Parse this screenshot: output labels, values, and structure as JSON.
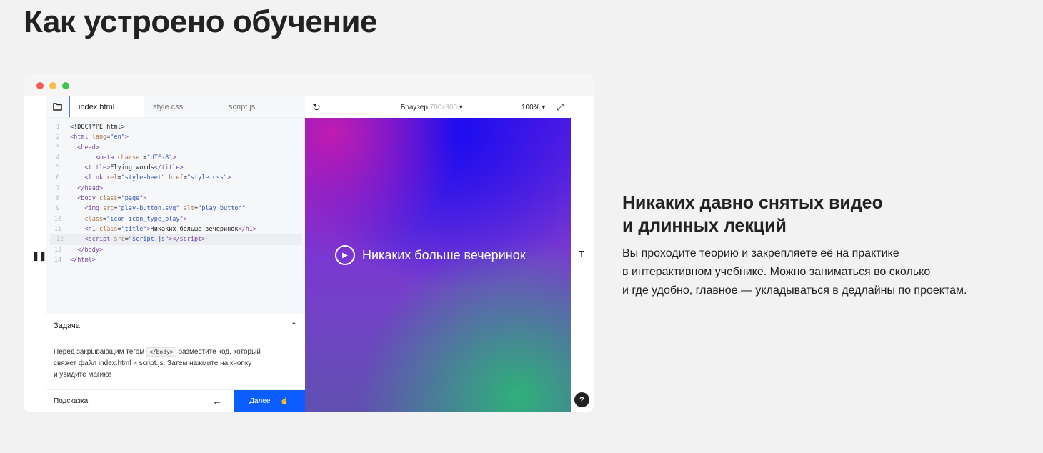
{
  "page_title": "Как устроено обучение",
  "window": {
    "tabs": [
      "index.html",
      "style.css",
      "script.js"
    ],
    "code": [
      [
        [
          "tx",
          "<!DOCTYPE html>"
        ]
      ],
      [
        [
          "tg",
          "<html "
        ],
        [
          "at",
          "lang"
        ],
        [
          "tx",
          "="
        ],
        [
          "st",
          "\"en\""
        ],
        [
          "tg",
          ">"
        ]
      ],
      [
        [
          "tg",
          "  <head>"
        ]
      ],
      [
        [
          "tg",
          "       <meta "
        ],
        [
          "at",
          "charset"
        ],
        [
          "tx",
          "="
        ],
        [
          "st",
          "\"UTF-8\""
        ],
        [
          "tg",
          ">"
        ]
      ],
      [
        [
          "tg",
          "    <title>"
        ],
        [
          "tx",
          "Flying words"
        ],
        [
          "tg",
          "</title>"
        ]
      ],
      [
        [
          "tg",
          "    <link "
        ],
        [
          "at",
          "rel"
        ],
        [
          "tx",
          "="
        ],
        [
          "st",
          "\"stylesheet\" "
        ],
        [
          "at",
          "href"
        ],
        [
          "tx",
          "="
        ],
        [
          "st",
          "\"style.css\""
        ],
        [
          "tg",
          ">"
        ]
      ],
      [
        [
          "tg",
          "  </head>"
        ]
      ],
      [
        [
          "tg",
          "  <body "
        ],
        [
          "at",
          "class"
        ],
        [
          "tx",
          "="
        ],
        [
          "st",
          "\"page\""
        ],
        [
          "tg",
          ">"
        ]
      ],
      [
        [
          "tg",
          "    <img "
        ],
        [
          "at",
          "src"
        ],
        [
          "tx",
          "="
        ],
        [
          "st",
          "\"play-button.svg\" "
        ],
        [
          "at",
          "alt"
        ],
        [
          "tx",
          "="
        ],
        [
          "st",
          "\"play button\""
        ]
      ],
      [
        [
          "at",
          "    class"
        ],
        [
          "tx",
          "="
        ],
        [
          "st",
          "\"icon icon_type_play\""
        ],
        [
          "tg",
          ">"
        ]
      ],
      [
        [
          "tg",
          "    <h1 "
        ],
        [
          "at",
          "class"
        ],
        [
          "tx",
          "="
        ],
        [
          "st",
          "\"title\""
        ],
        [
          "tg",
          ">"
        ],
        [
          "tx",
          "Никаких больше вечеринок"
        ],
        [
          "tg",
          "</h1>"
        ]
      ],
      [
        [
          "tg",
          "    <script "
        ],
        [
          "at",
          "src"
        ],
        [
          "tx",
          "="
        ],
        [
          "st",
          "\"script.js\""
        ],
        [
          "tg",
          "></script>"
        ]
      ],
      [
        [
          "tg",
          "  </body>"
        ]
      ],
      [
        [
          "tg",
          "</html>"
        ]
      ]
    ],
    "task": {
      "title": "Задача",
      "text_before": "Перед закрывающим тегом",
      "code": "</body>",
      "text_after": "разместите код, который",
      "line2": "свяжет файл index.html и script.js. Затем нажмите на кнопку",
      "line3": "и увидите магию!"
    },
    "hint_label": "Подсказка",
    "next_label": "Далее",
    "browser_label": "Браузер",
    "browser_size": "700x800",
    "zoom": "100%",
    "preview_title": "Никаких больше вечеринок",
    "right_strip_label": "T",
    "help_label": "?",
    "colors": {
      "accent": "#0a5eff",
      "dot_red": "#f25b57",
      "dot_yellow": "#f6c143",
      "dot_green": "#3fc351"
    }
  },
  "side": {
    "heading_line1": "Никаких давно снятых видео",
    "heading_line2": "и длинных лекций",
    "p_line1": "Вы проходите теорию и закрепляете её на практике",
    "p_line2": "в интерактивном учебнике. Можно заниматься во сколько",
    "p_line3": "и где удобно, главное — укладываться в дедлайны по проектам."
  }
}
